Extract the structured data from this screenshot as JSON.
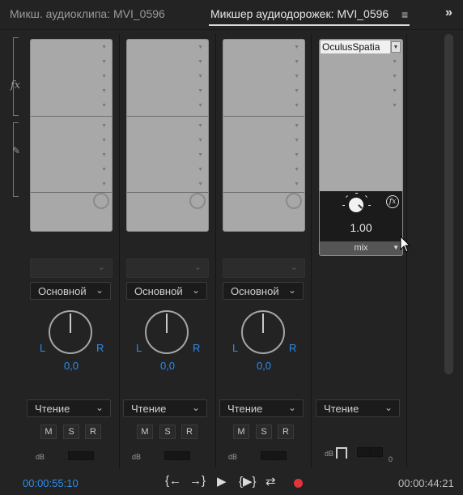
{
  "tabs": [
    {
      "label": "Микш. аудиоклипа: MVI_0596",
      "active": false
    },
    {
      "label": "Микшер аудиодорожек: MVI_0596",
      "active": true
    }
  ],
  "tab_menu_icon": "hamburger-menu-icon",
  "overflow_icon": "chevrons-right-icon",
  "left_labels": {
    "effects": "fx",
    "sends": "send-pen-icon"
  },
  "tracks": [
    {
      "output": "Основной",
      "pan_l": "L",
      "pan_r": "R",
      "pan_value": "0,0",
      "mode": "Чтение",
      "m": "M",
      "s": "S",
      "r": "R",
      "db": "dB"
    },
    {
      "output": "Основной",
      "pan_l": "L",
      "pan_r": "R",
      "pan_value": "0,0",
      "mode": "Чтение",
      "m": "M",
      "s": "S",
      "r": "R",
      "db": "dB"
    },
    {
      "output": "Основной",
      "pan_l": "L",
      "pan_r": "R",
      "pan_value": "0,0",
      "mode": "Чтение",
      "m": "M",
      "s": "S",
      "r": "R",
      "db": "dB"
    }
  ],
  "master": {
    "effect_name": "OculusSpatia",
    "param_value": "1.00",
    "param_mode": "mix",
    "mode": "Чтение",
    "db": "dB",
    "meter_zero": "0"
  },
  "transport": {
    "current_time": "00:00:55:10",
    "duration": "00:00:44:21",
    "buttons": [
      "go-to-in-icon",
      "go-to-out-icon",
      "play-icon",
      "play-in-to-out-icon",
      "loop-icon",
      "record-icon"
    ]
  },
  "colors": {
    "accent_blue": "#2d8ceb",
    "record_red": "#e5333a",
    "panel_bg": "#232323"
  }
}
